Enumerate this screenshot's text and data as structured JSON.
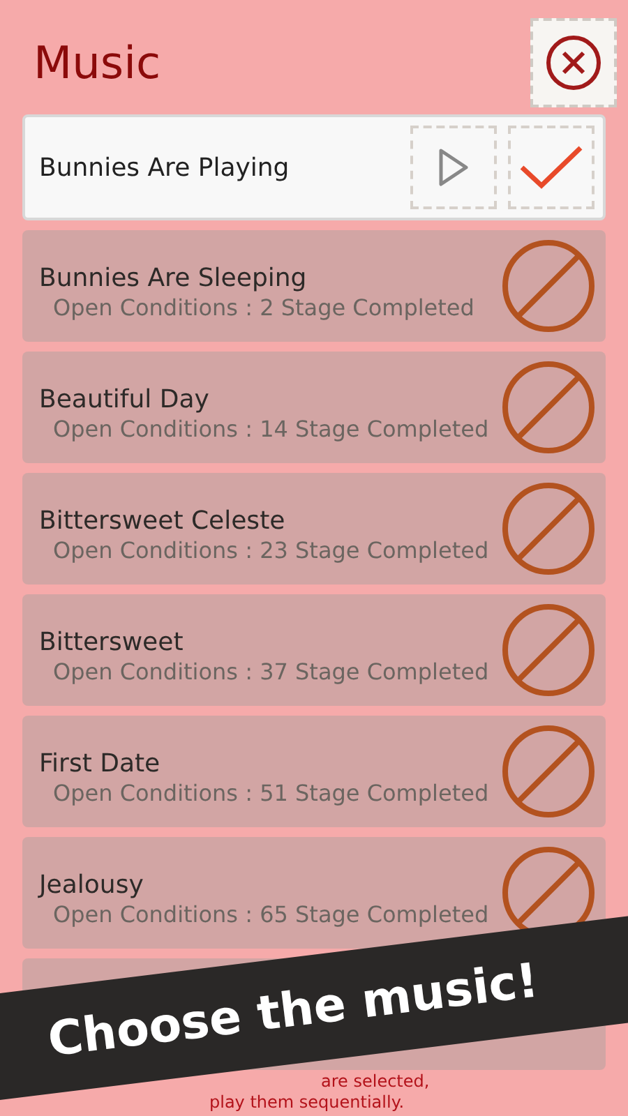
{
  "title": "Music",
  "songs": [
    {
      "kind": "current",
      "name": "Bunnies Are Playing",
      "checked": true
    },
    {
      "kind": "locked",
      "name": "Bunnies Are Sleeping",
      "condition": "Open Conditions : 2 Stage Completed"
    },
    {
      "kind": "locked",
      "name": "Beautiful Day",
      "condition": "Open Conditions : 14 Stage Completed"
    },
    {
      "kind": "locked",
      "name": "Bittersweet Celeste",
      "condition": "Open Conditions : 23 Stage Completed"
    },
    {
      "kind": "locked",
      "name": "Bittersweet",
      "condition": "Open Conditions : 37 Stage Completed"
    },
    {
      "kind": "locked",
      "name": "First Date",
      "condition": "Open Conditions : 51 Stage Completed"
    },
    {
      "kind": "locked",
      "name": "Jealousy",
      "condition": "Open Conditions : 65 Stage Completed"
    },
    {
      "kind": "hidden"
    }
  ],
  "note_lines": [
    "are selected,",
    "play them sequentially."
  ],
  "banner": "Choose the music!"
}
